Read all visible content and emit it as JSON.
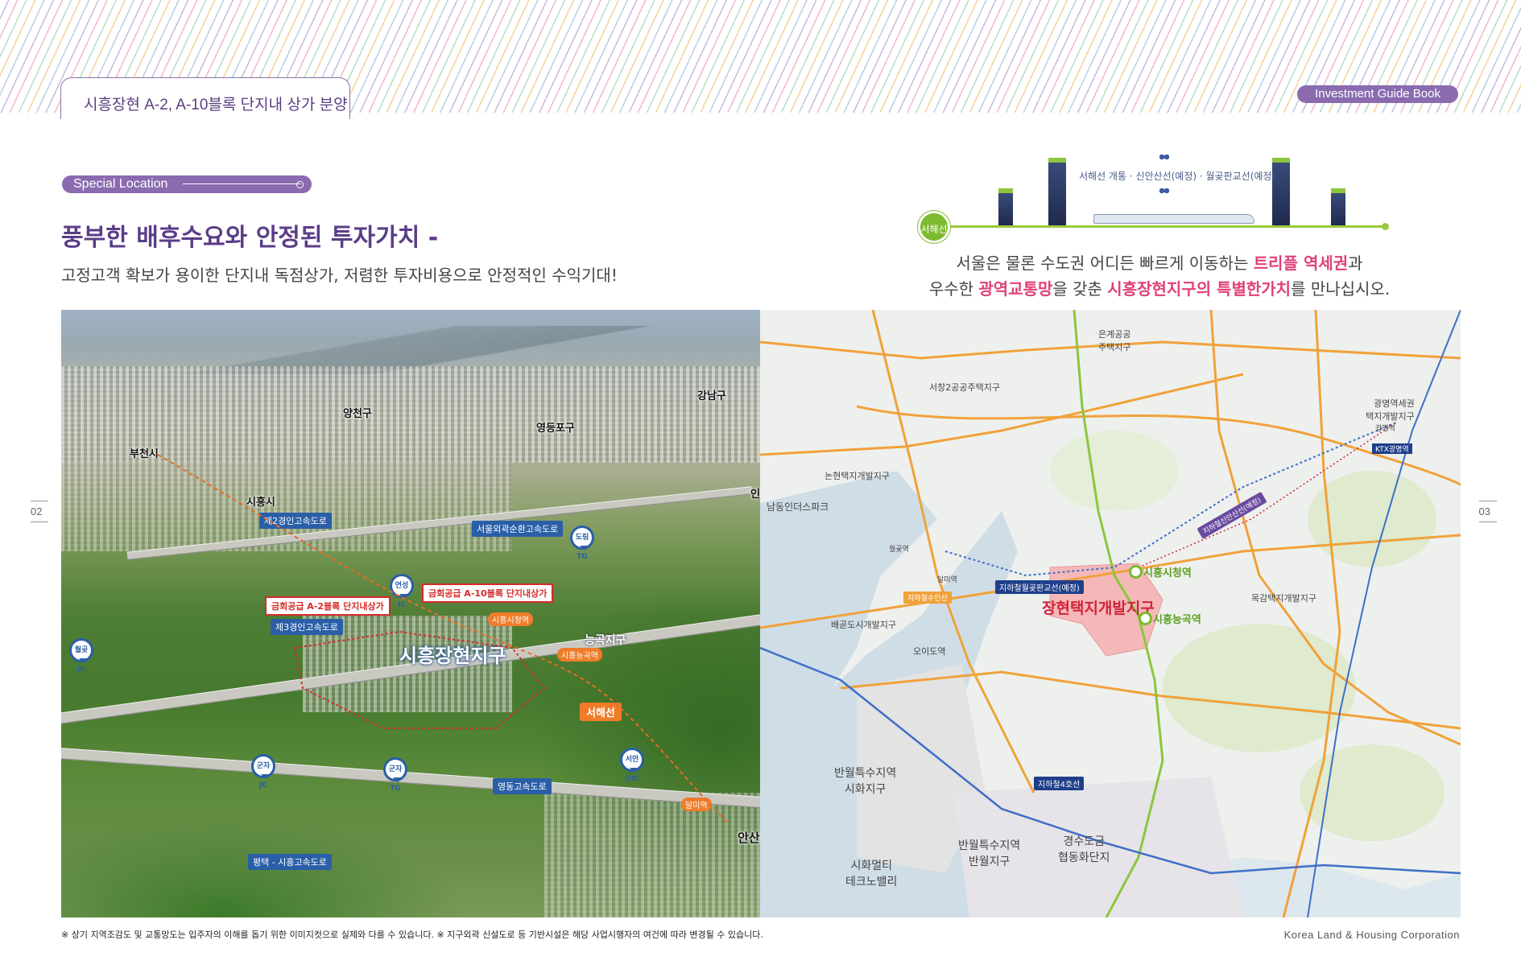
{
  "header": {
    "doc_title": "시흥장현 A-2, A-10블록 단지내 상가 분양",
    "guide_label": "Investment Guide Book"
  },
  "pages": {
    "left": "02",
    "right": "03"
  },
  "left": {
    "section_pill": "Special Location",
    "headline": "풍부한 배후수요와 안정된 투자가치 -",
    "subline": "고정고객 확보가 용이한 단지내 독점상가, 저렴한 투자비용으로 안정적인 수익기대!"
  },
  "right_top": {
    "rail_badge": "서해선",
    "rail_caption": "서해선 개통 · 신안산선(예정) · 월곶판교선(예정)",
    "tagline_1_pre": "서울은 물론 수도권 어디든 빠르게 이동하는 ",
    "tagline_1_hl": "트리플 역세권",
    "tagline_1_post": "과",
    "tagline_2_pre": "우수한 ",
    "tagline_2_hl1": "광역교통망",
    "tagline_2_mid": "을 갖춘 ",
    "tagline_2_hl2": "시흥장현지구의 특별한가치",
    "tagline_2_post": "를 만나십시오."
  },
  "aerial": {
    "labels": {
      "yangcheon": "양천구",
      "gangnam": "강남구",
      "yeongdeungpo": "영등포구",
      "bucheon": "부천시",
      "siheung_city": "시흥시",
      "neunggok": "능곡지구",
      "main": "시흥장현지구",
      "ansan": "안산",
      "in": "인"
    },
    "roads": {
      "r2": "제2경인고속도로",
      "outer": "서울외곽순환고속도로",
      "r3": "제3경인고속도로",
      "yeongdong": "영동고속도로",
      "pyeongtaek": "평택 - 시흥고속도로"
    },
    "callouts": {
      "a2": "금회공급 A-2블록 단지내상가",
      "a10": "금회공급 A-10블록 단지내상가"
    },
    "ics": {
      "dorim": "도림TG",
      "yeonseong": "연성IC",
      "wolgot": "월곶JC",
      "gunja_jc": "군자JC",
      "gunja_tg": "군자TG",
      "seoansan": "서안산IC"
    },
    "stations": {
      "siheung_city_st": "시흥시청역",
      "siheung_neunggok": "시흥능곡역",
      "dalmi": "달미역"
    },
    "line_tag": "서해선"
  },
  "map": {
    "district": "장현택지개발지구",
    "station_1": "시흥시청역",
    "station_2": "시흥능곡역",
    "labels": {
      "eunkye": "은계공공\n주택지구",
      "seochang": "서창2공공주택지구",
      "nonhyeon": "논현택지개발지구",
      "namdong": "남동인더스파크",
      "baegot": "배곧도시개발지구",
      "mokgam": "목감택지개발지구",
      "gwangmyeong": "광명역세권\n택지개발지구",
      "banwol_sihwa": "반월특수지역\n시화지구",
      "banwol": "반월특수지역\n반월지구",
      "gyeongsu": "경수도금\n협동화단지",
      "sihwa_mtv": "시화멀티\n테크노밸리",
      "ktx": "KTX광명역",
      "gwangmyeong_st": "광명역",
      "ojido": "오이도역",
      "wolgot": "월곶역",
      "dalmi": "달미역"
    },
    "line_tags": {
      "wolpan": "지하철월곶판교선(예정)",
      "line4": "지하철4호선",
      "sinansan": "지하철신안산선(예정)",
      "suin": "지하철수인선"
    }
  },
  "footer": {
    "note": "※ 상기 지역조감도 및 교통망도는 입주자의 이해를 돕기 위한 이미지컷으로 실제와 다를 수 있습니다.   ※ 지구외곽 신설도로 등 기반시설은 해당 사업시행자의 여건에 따라 변경될 수 있습니다.",
    "corp": "Korea Land & Housing Corporation"
  },
  "colors": {
    "purple": "#5b3d87",
    "pill": "#8a6bb0",
    "pink_highlight": "#e0407a",
    "green_rail": "#7dba2e",
    "road_blue": "#2a5fa8",
    "district_red": "#d0233a"
  }
}
